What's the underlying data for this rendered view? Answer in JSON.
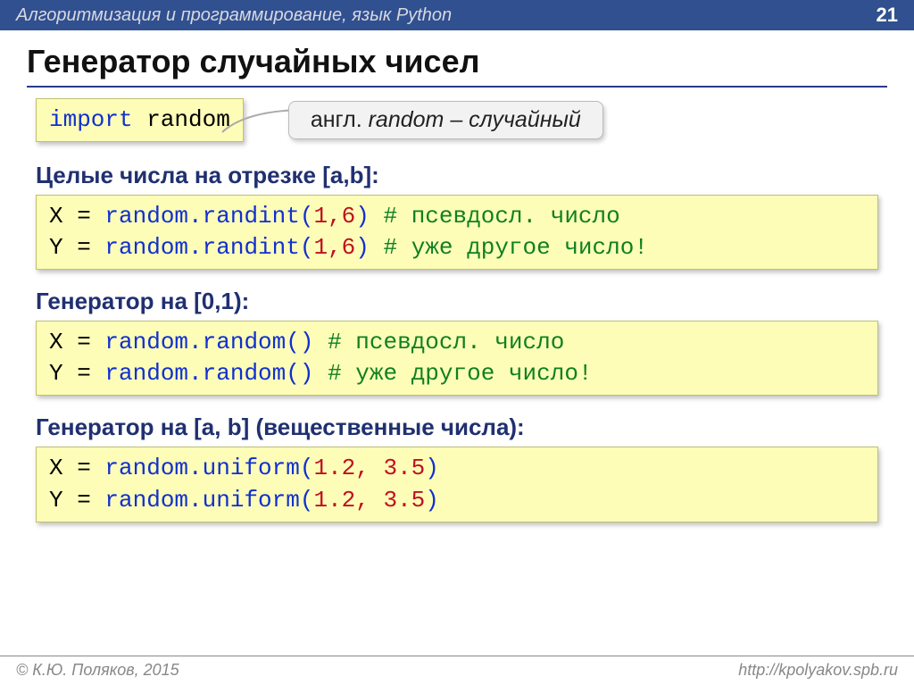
{
  "header": {
    "breadcrumb": "Алгоритмизация и программирование, язык Python",
    "page_number": "21"
  },
  "title": "Генератор случайных чисел",
  "import_code": {
    "kw": "import",
    "mod": " random"
  },
  "note": {
    "prefix": "англ. ",
    "word": "random",
    "suffix": " – случайный"
  },
  "sections": [
    {
      "heading": "Целые числа на отрезке [a,b]:",
      "lines": [
        {
          "lhs": "X = ",
          "call": "random.randint(",
          "args": "1,6",
          "rp": ")",
          "pad": " ",
          "comment": "# псевдосл. число"
        },
        {
          "lhs": "Y = ",
          "call": "random.randint(",
          "args": "1,6",
          "rp": ")",
          "pad": " ",
          "comment": "# уже другое число!"
        }
      ]
    },
    {
      "heading": "Генератор на [0,1):",
      "lines": [
        {
          "lhs": "X = ",
          "call": "random.random()",
          "args": "",
          "rp": "",
          "pad": "   ",
          "comment": "# псевдосл. число"
        },
        {
          "lhs": "Y = ",
          "call": "random.random()",
          "args": "",
          "rp": "",
          "pad": "   ",
          "comment": "# уже другое число!"
        }
      ]
    },
    {
      "heading": "Генератор на [a, b] (вещественные числа):",
      "lines": [
        {
          "lhs": "X = ",
          "call": "random.uniform(",
          "args": "1.2, 3.5",
          "rp": ")",
          "pad": "",
          "comment": ""
        },
        {
          "lhs": "Y = ",
          "call": "random.uniform(",
          "args": "1.2, 3.5",
          "rp": ")",
          "pad": "",
          "comment": ""
        }
      ]
    }
  ],
  "footer": {
    "copyright": "© К.Ю. Поляков, 2015",
    "url": "http://kpolyakov.spb.ru"
  }
}
